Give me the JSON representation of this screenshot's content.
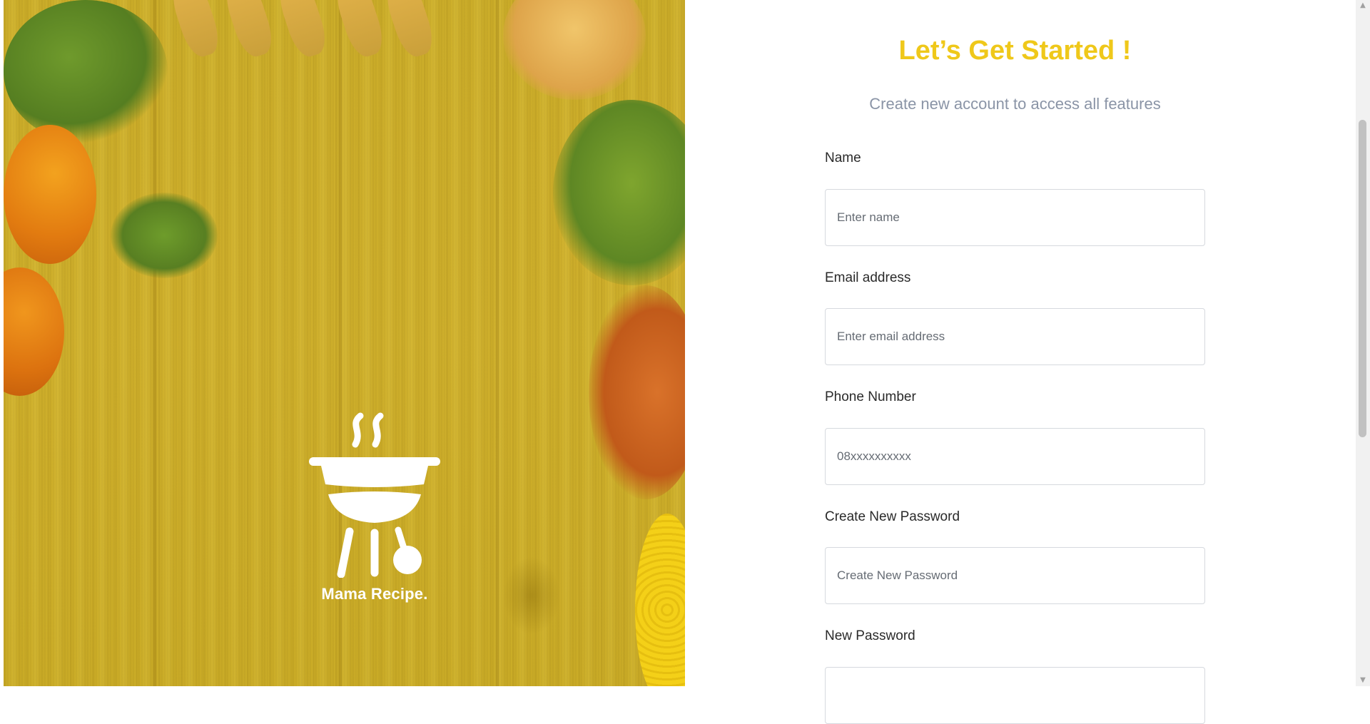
{
  "brand": {
    "name": "Mama Recipe.",
    "logo_icon": "grill-icon",
    "panel_color": "#d2b22c"
  },
  "header": {
    "title": "Let’s Get Started !",
    "subtitle": "Create new account to access all features",
    "title_color": "#efc81a"
  },
  "form": {
    "fields": [
      {
        "label": "Name",
        "placeholder": "Enter name",
        "value": ""
      },
      {
        "label": "Email address",
        "placeholder": "Enter email address",
        "value": ""
      },
      {
        "label": "Phone Number",
        "placeholder": "08xxxxxxxxxx",
        "value": ""
      },
      {
        "label": "Create New Password",
        "placeholder": "Create New Password",
        "value": ""
      },
      {
        "label": "New Password",
        "placeholder": "",
        "value": ""
      }
    ]
  },
  "scrollbar": {
    "up_icon": "arrow-up-icon",
    "down_icon": "arrow-down-icon"
  }
}
